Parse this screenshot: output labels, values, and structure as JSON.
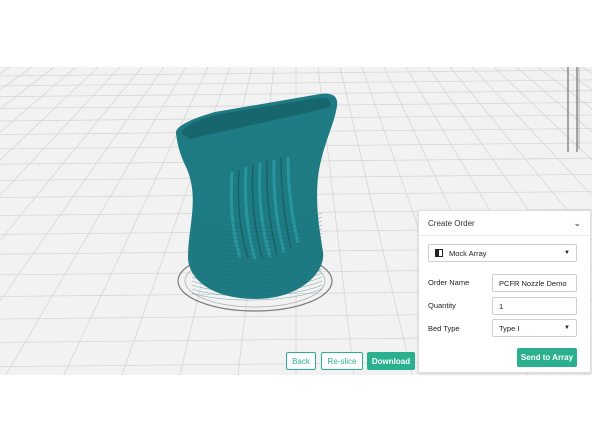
{
  "toolbar": {
    "back_label": "Back",
    "reslice_label": "Re-slice",
    "download_label": "Download"
  },
  "order_panel": {
    "title": "Create Order",
    "printer_select": "Mock Array",
    "order_name_label": "Order Name",
    "order_name_value": "PCFR Nozzle Demo",
    "quantity_label": "Quantity",
    "quantity_value": "1",
    "bed_type_label": "Bed Type",
    "bed_type_value": "Type I",
    "send_label": "Send to Array"
  },
  "colors": {
    "accent": "#2bb08f",
    "model": "#1f7b83",
    "grid_background": "#f2f2f2"
  },
  "icons": [
    "chevron-down-icon",
    "printer-icon",
    "dropdown-caret-icon"
  ]
}
